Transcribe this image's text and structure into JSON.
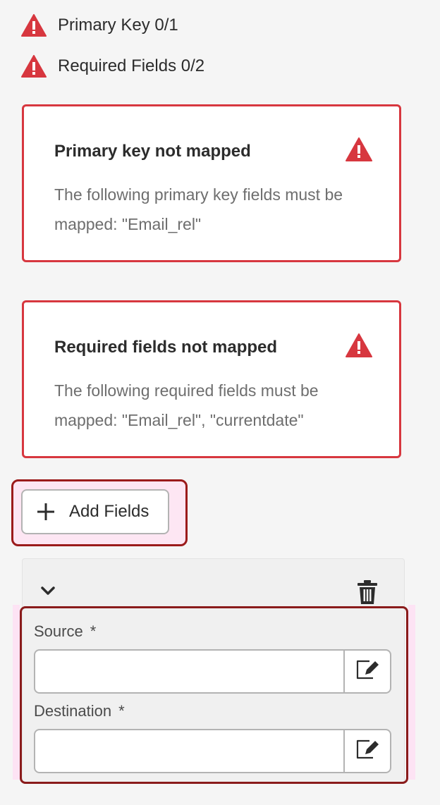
{
  "status": {
    "primary_key": "Primary Key 0/1",
    "required_fields": "Required Fields 0/2"
  },
  "errors": [
    {
      "title": "Primary key not mapped",
      "body": "The following primary key fields must be mapped: \"Email_rel\""
    },
    {
      "title": "Required fields not mapped",
      "body": "The following required fields must be mapped: \"Email_rel\", \"currentdate\""
    }
  ],
  "add_fields_label": "Add Fields",
  "mapping": {
    "source_label": "Source",
    "destination_label": "Destination",
    "required_marker": "*",
    "source_value": "",
    "destination_value": ""
  },
  "icons": {
    "warning": "warning-triangle-icon",
    "add": "plus-icon",
    "collapse": "chevron-down-icon",
    "delete": "trash-icon",
    "edit": "edit-icon"
  },
  "colors": {
    "error": "#d7373f",
    "highlight_border": "#8a1b1b",
    "highlight_fill": "#fde6f3"
  }
}
